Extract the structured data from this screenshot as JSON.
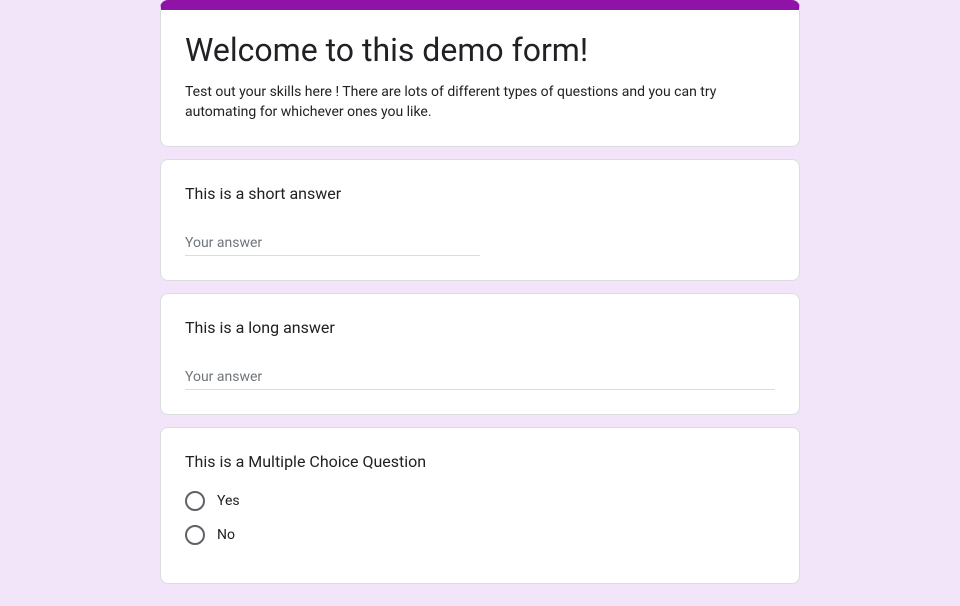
{
  "header": {
    "title": "Welcome to this demo form!",
    "description": "Test out your skills here ! There are lots of different types of questions and you can try automating for whichever ones you like."
  },
  "questions": {
    "short_answer": {
      "title": "This is a short answer",
      "placeholder": "Your answer"
    },
    "long_answer": {
      "title": "This is a long answer",
      "placeholder": "Your answer"
    },
    "multiple_choice": {
      "title": "This is a Multiple Choice Question",
      "options": [
        "Yes",
        "No"
      ]
    }
  }
}
